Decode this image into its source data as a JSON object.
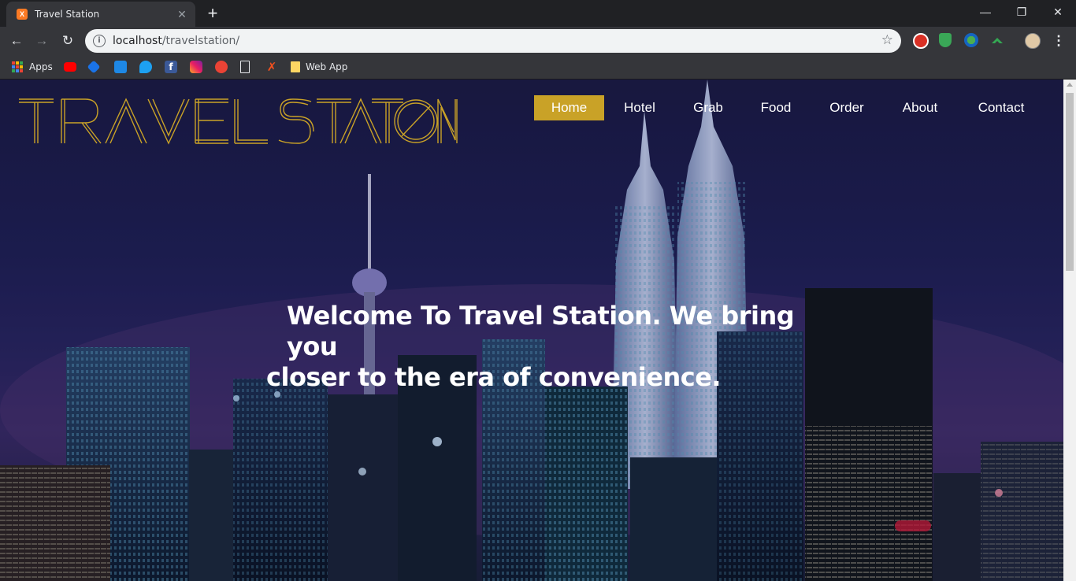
{
  "browser": {
    "tab_title": "Travel Station",
    "tab_favicon": "X",
    "url_host": "localhost",
    "url_path": "/travelstation/",
    "bookmarks": [
      {
        "label": "Apps",
        "icon": "apps-grid-icon"
      },
      {
        "label": "",
        "icon": "youtube-icon"
      },
      {
        "label": "",
        "icon": "pen-icon"
      },
      {
        "label": "",
        "icon": "bag-icon"
      },
      {
        "label": "",
        "icon": "twitter-icon"
      },
      {
        "label": "",
        "icon": "facebook-icon"
      },
      {
        "label": "",
        "icon": "instagram-icon"
      },
      {
        "label": "",
        "icon": "play-icon"
      },
      {
        "label": "",
        "icon": "page-icon"
      },
      {
        "label": "",
        "icon": "x-icon"
      },
      {
        "label": "Web App",
        "icon": "note-icon"
      }
    ]
  },
  "site": {
    "logo_text": "TRAVEL STATION",
    "nav": [
      {
        "label": "Home",
        "active": true
      },
      {
        "label": "Hotel",
        "active": false
      },
      {
        "label": "Grab",
        "active": false
      },
      {
        "label": "Food",
        "active": false
      },
      {
        "label": "Order",
        "active": false
      },
      {
        "label": "About",
        "active": false
      },
      {
        "label": "Contact",
        "active": false
      }
    ],
    "hero_line1": "Welcome To Travel Station. We bring you",
    "hero_line2": "closer to the era of convenience."
  },
  "colors": {
    "accent": "#c9a227",
    "chrome_dark": "#202124",
    "chrome_toolbar": "#35363a"
  }
}
